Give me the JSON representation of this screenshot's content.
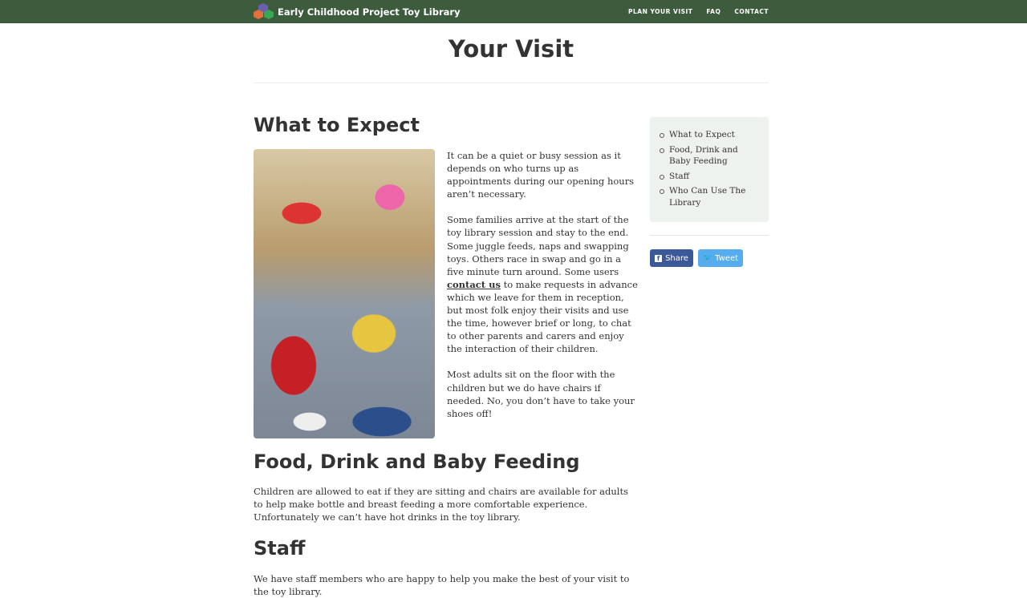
{
  "header": {
    "site_title": "Early Childhood Project Toy Library",
    "nav": [
      "PLAN YOUR VISIT",
      "FAQ",
      "CONTACT"
    ]
  },
  "page": {
    "title": "Your Visit"
  },
  "sections": {
    "expect": {
      "heading": "What to Expect",
      "p1": "It can be a quiet or busy session as it depends on who turns up as appointments during our opening hours aren’t necessary.",
      "p2_before": "Some families arrive at the start of the toy library session and stay to the end. Some juggle feeds, naps and swapping toys. Others race in swap and go in a five minute turn around. Some users ",
      "p2_link": "contact us",
      "p2_after": " to make requests in advance which we leave for them in reception, but most folk enjoy their visits and use the time, however brief or long, to chat to other parents and carers and enjoy the interaction of their children.",
      "p3": "Most adults sit on the floor with the children but we do have chairs if needed. No, you don’t have to take your shoes off!"
    },
    "food": {
      "heading": "Food, Drink and Baby Feeding",
      "text": "Children are allowed to eat if they are sitting and chairs are available for adults to help make bottle and breast feeding a more comfortable experience. Unfortunately we can’t have hot drinks in the toy library."
    },
    "staff": {
      "heading": "Staff",
      "text": "We have staff members who are happy to help you make the best of your visit to the toy library."
    }
  },
  "sidebar": {
    "toc": [
      "What to Expect",
      "Food, Drink and Baby Feeding",
      "Staff",
      "Who Can Use The Library"
    ],
    "share_label": "Share",
    "tweet_label": "Tweet"
  },
  "colors": {
    "topbar": "#3d5b3d",
    "toc_bg": "#eef2ee",
    "facebook": "#3b5998",
    "twitter": "#55acee"
  }
}
